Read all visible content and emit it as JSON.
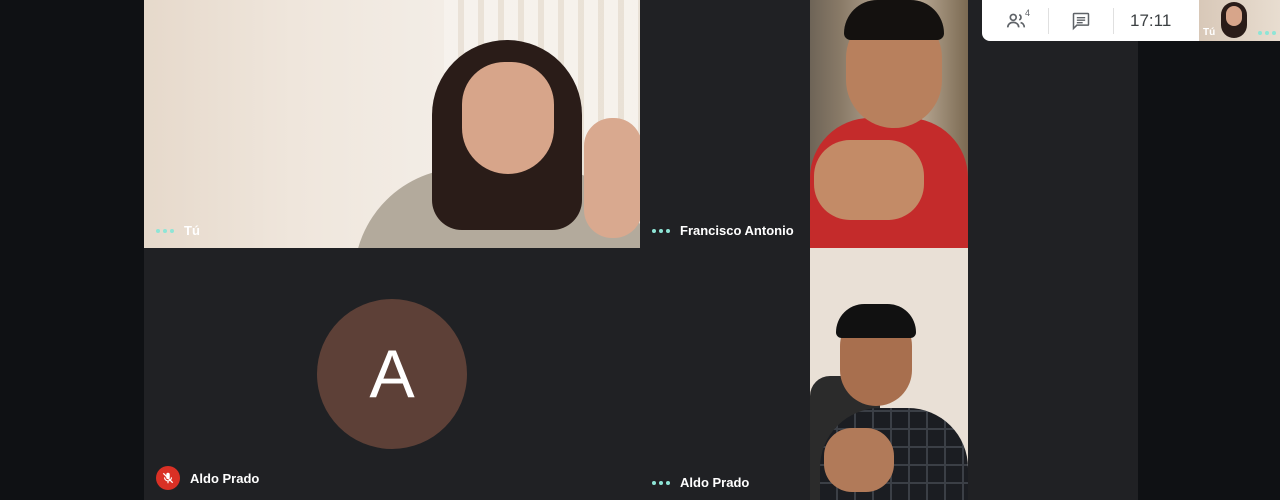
{
  "toolbar": {
    "participants_count": "4",
    "time": "17:11"
  },
  "participants": [
    {
      "name": "Tú"
    },
    {
      "name": "Francisco Antonio"
    },
    {
      "name": "Aldo Prado",
      "avatar_letter": "A",
      "avatar_color": "#5d4037",
      "muted": true
    },
    {
      "name": "Aldo Prado"
    }
  ],
  "self_preview": {
    "label": "Tú"
  },
  "icons": {
    "people": "people-icon",
    "chat": "chat-icon",
    "mic_off": "mic-off-icon",
    "speaking": "speaking-dots-icon"
  },
  "colors": {
    "tile_bg": "#202124",
    "speaking_dots": "#8ee5d6",
    "muted_red": "#d93025"
  }
}
